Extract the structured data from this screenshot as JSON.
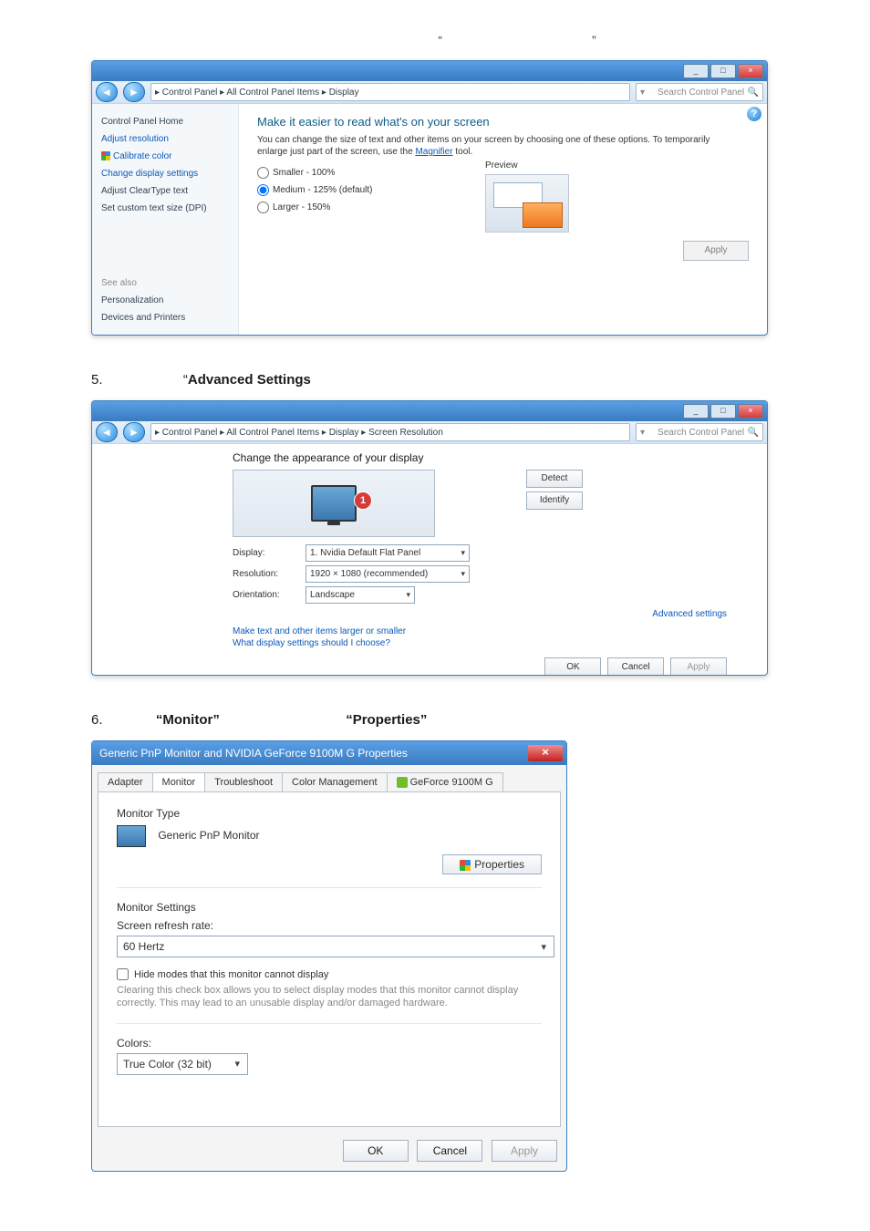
{
  "intro": {
    "left_quote": "“",
    "right_quote": "”"
  },
  "display_win": {
    "breadcrumb": "▸ Control Panel ▸ All Control Panel Items ▸ Display",
    "search_placeholder": "Search Control Panel",
    "title_buttons": {
      "min": "_",
      "max": "□",
      "close": "×"
    },
    "sidebar": {
      "home": "Control Panel Home",
      "adjust_res": "Adjust resolution",
      "calibrate": "Calibrate color",
      "change_disp": "Change display settings",
      "cleartype": "Adjust ClearType text",
      "custom_dpi": "Set custom text size (DPI)",
      "see_also": "See also",
      "personalization": "Personalization",
      "devices": "Devices and Printers"
    },
    "main": {
      "heading": "Make it easier to read what's on your screen",
      "blurb_pre": "You can change the size of text and other items on your screen by choosing one of these options. To temporarily enlarge just part of the screen, use the ",
      "blurb_link": "Magnifier",
      "blurb_post": " tool.",
      "opt_small": "Smaller - 100%",
      "opt_medium": "Medium - 125% (default)",
      "opt_large": "Larger - 150%",
      "preview_label": "Preview",
      "apply": "Apply"
    }
  },
  "step5": {
    "num": "5.",
    "quoted": "“Advanced Settings”"
  },
  "res_win": {
    "breadcrumb": "▸ Control Panel ▸ All Control Panel Items ▸ Display ▸ Screen Resolution",
    "search_placeholder": "Search Control Panel",
    "heading": "Change the appearance of your display",
    "detect": "Detect",
    "identify": "Identify",
    "row_display": "Display:",
    "val_display": "1. Nvidia Default Flat Panel",
    "row_res": "Resolution:",
    "val_res": "1920 × 1080 (recommended)",
    "row_orient": "Orientation:",
    "val_orient": "Landscape",
    "advanced": "Advanced settings",
    "link_larger": "Make text and other items larger or smaller",
    "link_which": "What display settings should I choose?",
    "ok": "OK",
    "cancel": "Cancel",
    "apply": "Apply",
    "badge": "1"
  },
  "step6": {
    "num": "6.",
    "q1": "“Monitor”",
    "q2": "“Properties”"
  },
  "prop_win": {
    "title": "Generic PnP Monitor and NVIDIA GeForce 9100M G   Properties",
    "tabs": {
      "adapter": "Adapter",
      "monitor": "Monitor",
      "troubleshoot": "Troubleshoot",
      "colormgmt": "Color Management",
      "nv": "GeForce 9100M G"
    },
    "monitor_type": "Monitor Type",
    "monitor_name": "Generic PnP Monitor",
    "properties_btn": "Properties",
    "monitor_settings": "Monitor Settings",
    "refresh_label": "Screen refresh rate:",
    "refresh_value": "60 Hertz",
    "hide_modes": "Hide modes that this monitor cannot display",
    "hide_hint": "Clearing this check box allows you to select display modes that this monitor cannot display correctly. This may lead to an unusable display and/or damaged hardware.",
    "colors_label": "Colors:",
    "colors_value": "True Color (32 bit)",
    "ok": "OK",
    "cancel": "Cancel",
    "apply": "Apply"
  }
}
